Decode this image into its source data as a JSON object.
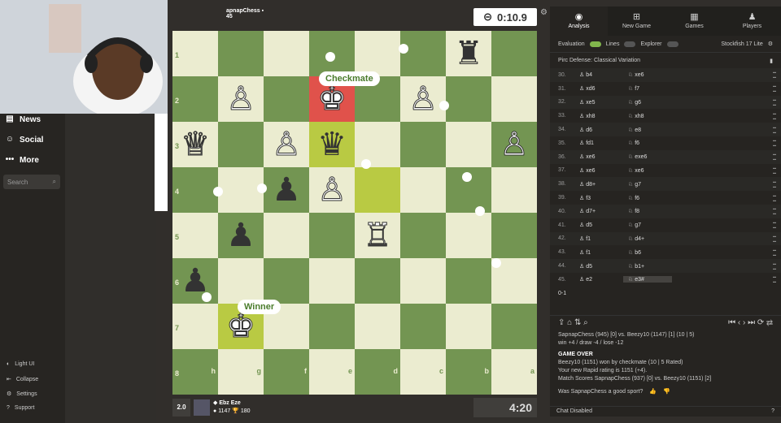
{
  "nav": {
    "items": [
      {
        "label": "News",
        "icon": "news-icon"
      },
      {
        "label": "Social",
        "icon": "social-icon"
      },
      {
        "label": "More",
        "icon": "more-icon"
      }
    ],
    "search_placeholder": "Search",
    "footer": [
      {
        "label": "Light UI"
      },
      {
        "label": "Collapse"
      },
      {
        "label": "Settings"
      },
      {
        "label": "Support"
      }
    ]
  },
  "top_player": {
    "name": "apnapChess",
    "rating": "45"
  },
  "top_clock": "0:10.9",
  "board": {
    "ranks": [
      "1",
      "2",
      "3",
      "4",
      "5",
      "6",
      "7",
      "8"
    ],
    "files": [
      "h",
      "g",
      "f",
      "e",
      "d",
      "c",
      "b",
      "a"
    ],
    "checkmate_label": "Checkmate",
    "winner_label": "Winner"
  },
  "bottom_player": {
    "score": "2.0",
    "name": "Ebz Eze",
    "rating": "1147",
    "trophy": "180"
  },
  "bottom_clock": "4:20",
  "tabs": [
    {
      "label": "Analysis",
      "active": true
    },
    {
      "label": "New Game",
      "active": false
    },
    {
      "label": "Games",
      "active": false
    },
    {
      "label": "Players",
      "active": false
    }
  ],
  "toggles": {
    "evaluation": "Evaluation",
    "lines": "Lines",
    "explorer": "Explorer",
    "engine": "Stockfish 17 Lite"
  },
  "opening": "Pirc Defense: Classical Variation",
  "moves": [
    {
      "n": "30.",
      "w": "b4",
      "b": "xe6"
    },
    {
      "n": "31.",
      "w": "xd6",
      "b": "f7"
    },
    {
      "n": "32.",
      "w": "xe5",
      "b": "g6"
    },
    {
      "n": "33.",
      "w": "xh8",
      "b": "xh8"
    },
    {
      "n": "34.",
      "w": "d6",
      "b": "e8"
    },
    {
      "n": "35.",
      "w": "fd1",
      "b": "f6"
    },
    {
      "n": "36.",
      "w": "xe6",
      "b": "exe6"
    },
    {
      "n": "37.",
      "w": "xe6",
      "b": "xe6"
    },
    {
      "n": "38.",
      "w": "d8+",
      "b": "g7"
    },
    {
      "n": "39.",
      "w": "f3",
      "b": "f6"
    },
    {
      "n": "40.",
      "w": "d7+",
      "b": "f8"
    },
    {
      "n": "41.",
      "w": "d5",
      "b": "g7"
    },
    {
      "n": "42.",
      "w": "f1",
      "b": "d4+"
    },
    {
      "n": "43.",
      "w": "f1",
      "b": "b6"
    },
    {
      "n": "44.",
      "w": "d5",
      "b": "b1+"
    },
    {
      "n": "45.",
      "w": "e2",
      "b": "e3#"
    }
  ],
  "result": "0-1",
  "chat": {
    "line1": "SapnapChess (945) [0] vs. Beezy10 (1147) [1] (10 | 5)",
    "line2": "win +4 / draw -4 / lose -12",
    "game_over": "GAME OVER",
    "line3": "Beezy10 (1151) won by checkmate (10 | 5 Rated)",
    "line4": "Your new Rapid rating is 1151 (+4).",
    "line5": "Match Scores SapnapChess (937) [0] vs. Beezy10 (1151) [2]",
    "good_sport": "Was SapnapChess a good sport?",
    "disabled": "Chat Disabled"
  }
}
